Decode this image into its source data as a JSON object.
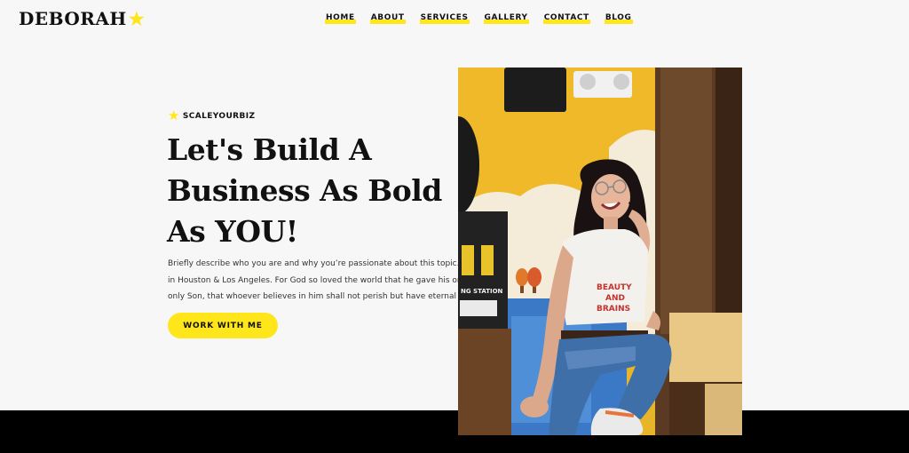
{
  "brand": {
    "name": "DEBORAH",
    "star_icon": "star-icon",
    "accent": "#ffe61b"
  },
  "nav": {
    "items": [
      {
        "label": "HOME"
      },
      {
        "label": "ABOUT"
      },
      {
        "label": "SERVICES"
      },
      {
        "label": "GALLERY"
      },
      {
        "label": "CONTACT"
      },
      {
        "label": "BLOG"
      }
    ]
  },
  "hero": {
    "eyebrow": "SCALEYOURBIZ",
    "headline": [
      "Let's Build A",
      "Business As Bold",
      "As YOU!"
    ],
    "description": [
      "Briefly describe who you are and why you’re passionate about this topic. Based",
      "in Houston & Los Angeles. For God so loved the world that he gave his one and",
      "only Son, that whoever believes in him shall not perish but have eternal life."
    ],
    "cta_label": "WORK WITH ME",
    "photo": {
      "shirt_text": [
        "BEAUTY",
        "AND",
        "BRAINS"
      ],
      "sign_text": "NG STATION"
    }
  },
  "colors": {
    "accent": "#ffe61b",
    "background": "#f7f7f7",
    "footer": "#000000"
  }
}
